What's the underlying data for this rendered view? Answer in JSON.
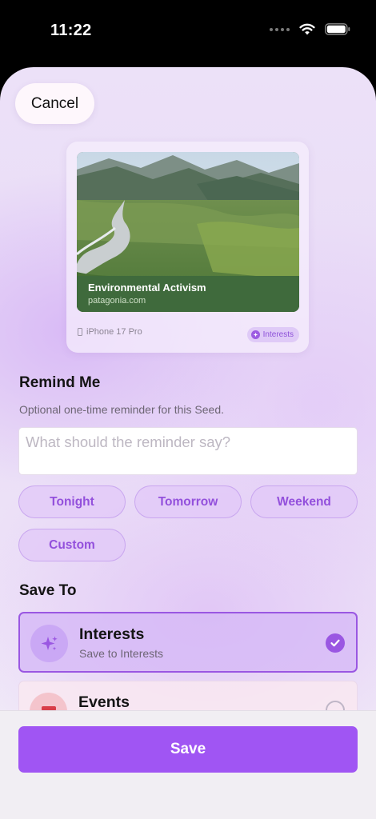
{
  "status_bar": {
    "time": "11:22"
  },
  "header": {
    "cancel_label": "Cancel"
  },
  "preview": {
    "title": "Environmental Activism",
    "domain": "patagonia.com",
    "device": "iPhone 17 Pro",
    "tag": "Interests"
  },
  "remind": {
    "title": "Remind Me",
    "subtitle": "Optional one-time reminder for this Seed.",
    "placeholder": "What should the reminder say?",
    "chips": [
      "Tonight",
      "Tomorrow",
      "Weekend",
      "Custom"
    ]
  },
  "save_to": {
    "title": "Save To",
    "options": [
      {
        "name": "Interests",
        "subtitle": "Save to Interests",
        "selected": true,
        "icon": "sparkles-icon"
      },
      {
        "name": "Events",
        "subtitle": "",
        "selected": false,
        "icon": "calendar-icon"
      }
    ]
  },
  "footer": {
    "save_label": "Save"
  },
  "colors": {
    "accent": "#a055f3",
    "accent_text": "#9350dc"
  }
}
